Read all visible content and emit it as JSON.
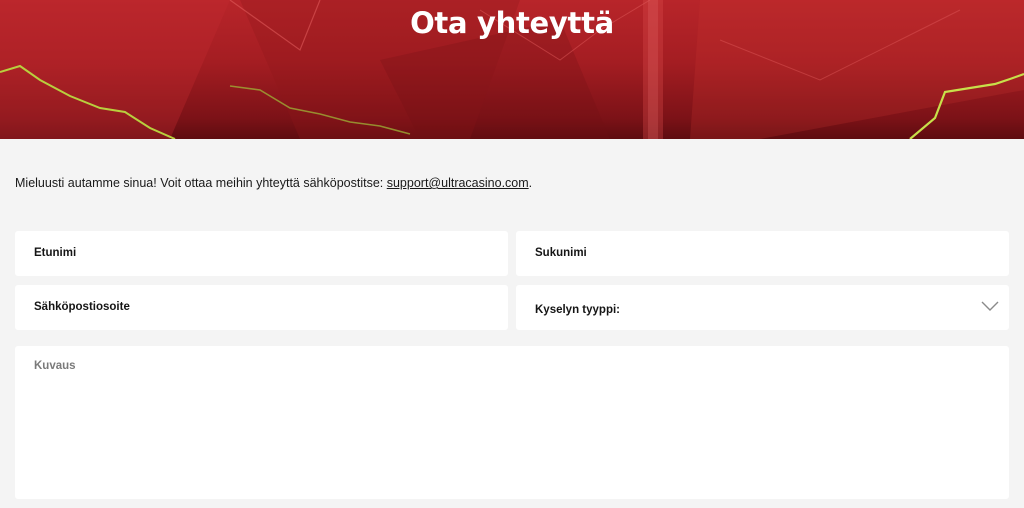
{
  "hero": {
    "title": "Ota yhteyttä"
  },
  "intro": {
    "text": "Mieluusti autamme sinua! Voit ottaa meihin yhteyttä sähköpostitse: ",
    "email": "support@ultracasino.com",
    "suffix": "."
  },
  "form": {
    "first_name_placeholder": "Etunimi",
    "last_name_placeholder": "Sukunimi",
    "email_placeholder": "Sähköpostiosoite",
    "inquiry_type_label": "Kyselyn tyyppi:",
    "description_placeholder": "Kuvaus"
  },
  "colors": {
    "hero_red": "#b8252a",
    "accent_lime": "#c8e04a",
    "page_bg": "#f4f4f4",
    "field_bg": "#ffffff"
  },
  "icons": {
    "inquiry_dropdown": "chevron-down-icon"
  }
}
